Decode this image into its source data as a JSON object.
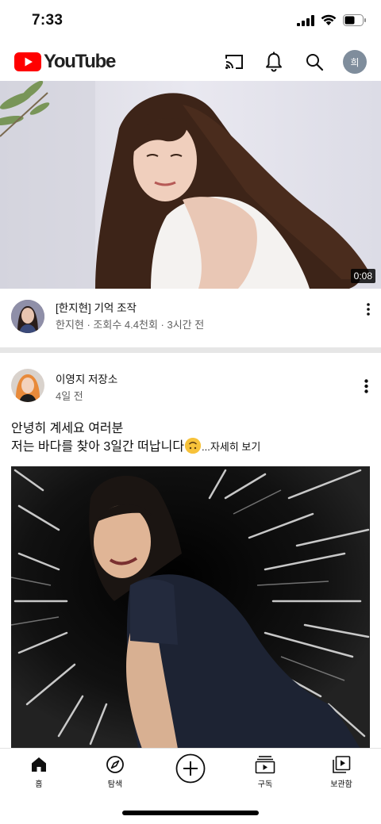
{
  "status_bar": {
    "time": "7:33"
  },
  "header": {
    "logo_text": "YouTube",
    "brand_color": "#ff0000",
    "icons": [
      "cast-icon",
      "notifications-icon",
      "search-icon"
    ],
    "account_initial": "희"
  },
  "video": {
    "title": "[한지현] 기억 조작",
    "channel": "한지현",
    "views": "조회수 4.4천회",
    "age": "3시간 전",
    "sub_line": "한지현 · 조회수 4.4천회 · 3시간 전",
    "duration": "0:08"
  },
  "post": {
    "channel": "이영지 저장소",
    "time": "4일 전",
    "text_line1": "안녕히 계세요 여러분",
    "text_line2": "저는 바다를 찾아 3일간 떠납니다",
    "emoji": "upside-down-face",
    "more_label": "...자세히 보기"
  },
  "bottom_nav": {
    "items": [
      {
        "label": "홈",
        "icon": "home-icon",
        "active": true
      },
      {
        "label": "탐색",
        "icon": "explore-icon"
      },
      {
        "label": "",
        "icon": "create-icon"
      },
      {
        "label": "구독",
        "icon": "subscriptions-icon"
      },
      {
        "label": "보관함",
        "icon": "library-icon"
      }
    ]
  }
}
